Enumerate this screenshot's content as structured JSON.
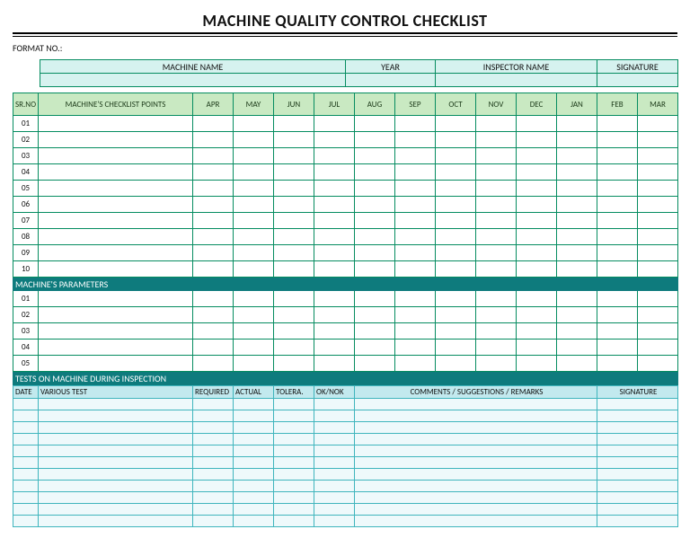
{
  "title": "MACHINE QUALITY CONTROL CHECKLIST",
  "format_no_label": "FORMAT NO.:",
  "header": {
    "machine_name_label": "MACHINE NAME",
    "year_label": "YEAR",
    "inspector_label": "INSPECTOR NAME",
    "signature_label": "SIGNATURE",
    "machine_name_value": "",
    "year_value": "",
    "inspector_value": "",
    "signature_value": ""
  },
  "grid": {
    "srno_label": "SR.NO",
    "checkpoints_label": "MACHINE'S CHECKLIST POINTS",
    "months": [
      "APR",
      "MAY",
      "JUN",
      "JUL",
      "AUG",
      "SEP",
      "OCT",
      "NOV",
      "DEC",
      "JAN",
      "FEB",
      "MAR"
    ]
  },
  "checklist_rows": [
    {
      "sr": "01"
    },
    {
      "sr": "02"
    },
    {
      "sr": "03"
    },
    {
      "sr": "04"
    },
    {
      "sr": "05"
    },
    {
      "sr": "06"
    },
    {
      "sr": "07"
    },
    {
      "sr": "08"
    },
    {
      "sr": "09"
    },
    {
      "sr": "10"
    }
  ],
  "section_parameters": "MACHINE'S PARAMETERS",
  "parameter_rows": [
    {
      "sr": "01"
    },
    {
      "sr": "02"
    },
    {
      "sr": "03"
    },
    {
      "sr": "04"
    },
    {
      "sr": "05"
    }
  ],
  "section_tests": "TESTS ON MACHINE DURING INSPECTION",
  "tests": {
    "date_label": "DATE",
    "various_test_label": "VARIOUS TEST",
    "required_label": "REQUIRED",
    "actual_label": "ACTUAL",
    "tolera_label": "TOLERA.",
    "oknok_label": "OK/NOK",
    "comments_label": "COMMENTS / SUGGESTIONS / REMARKS",
    "signature_label": "SIGNATURE"
  },
  "test_rows_count": 11
}
